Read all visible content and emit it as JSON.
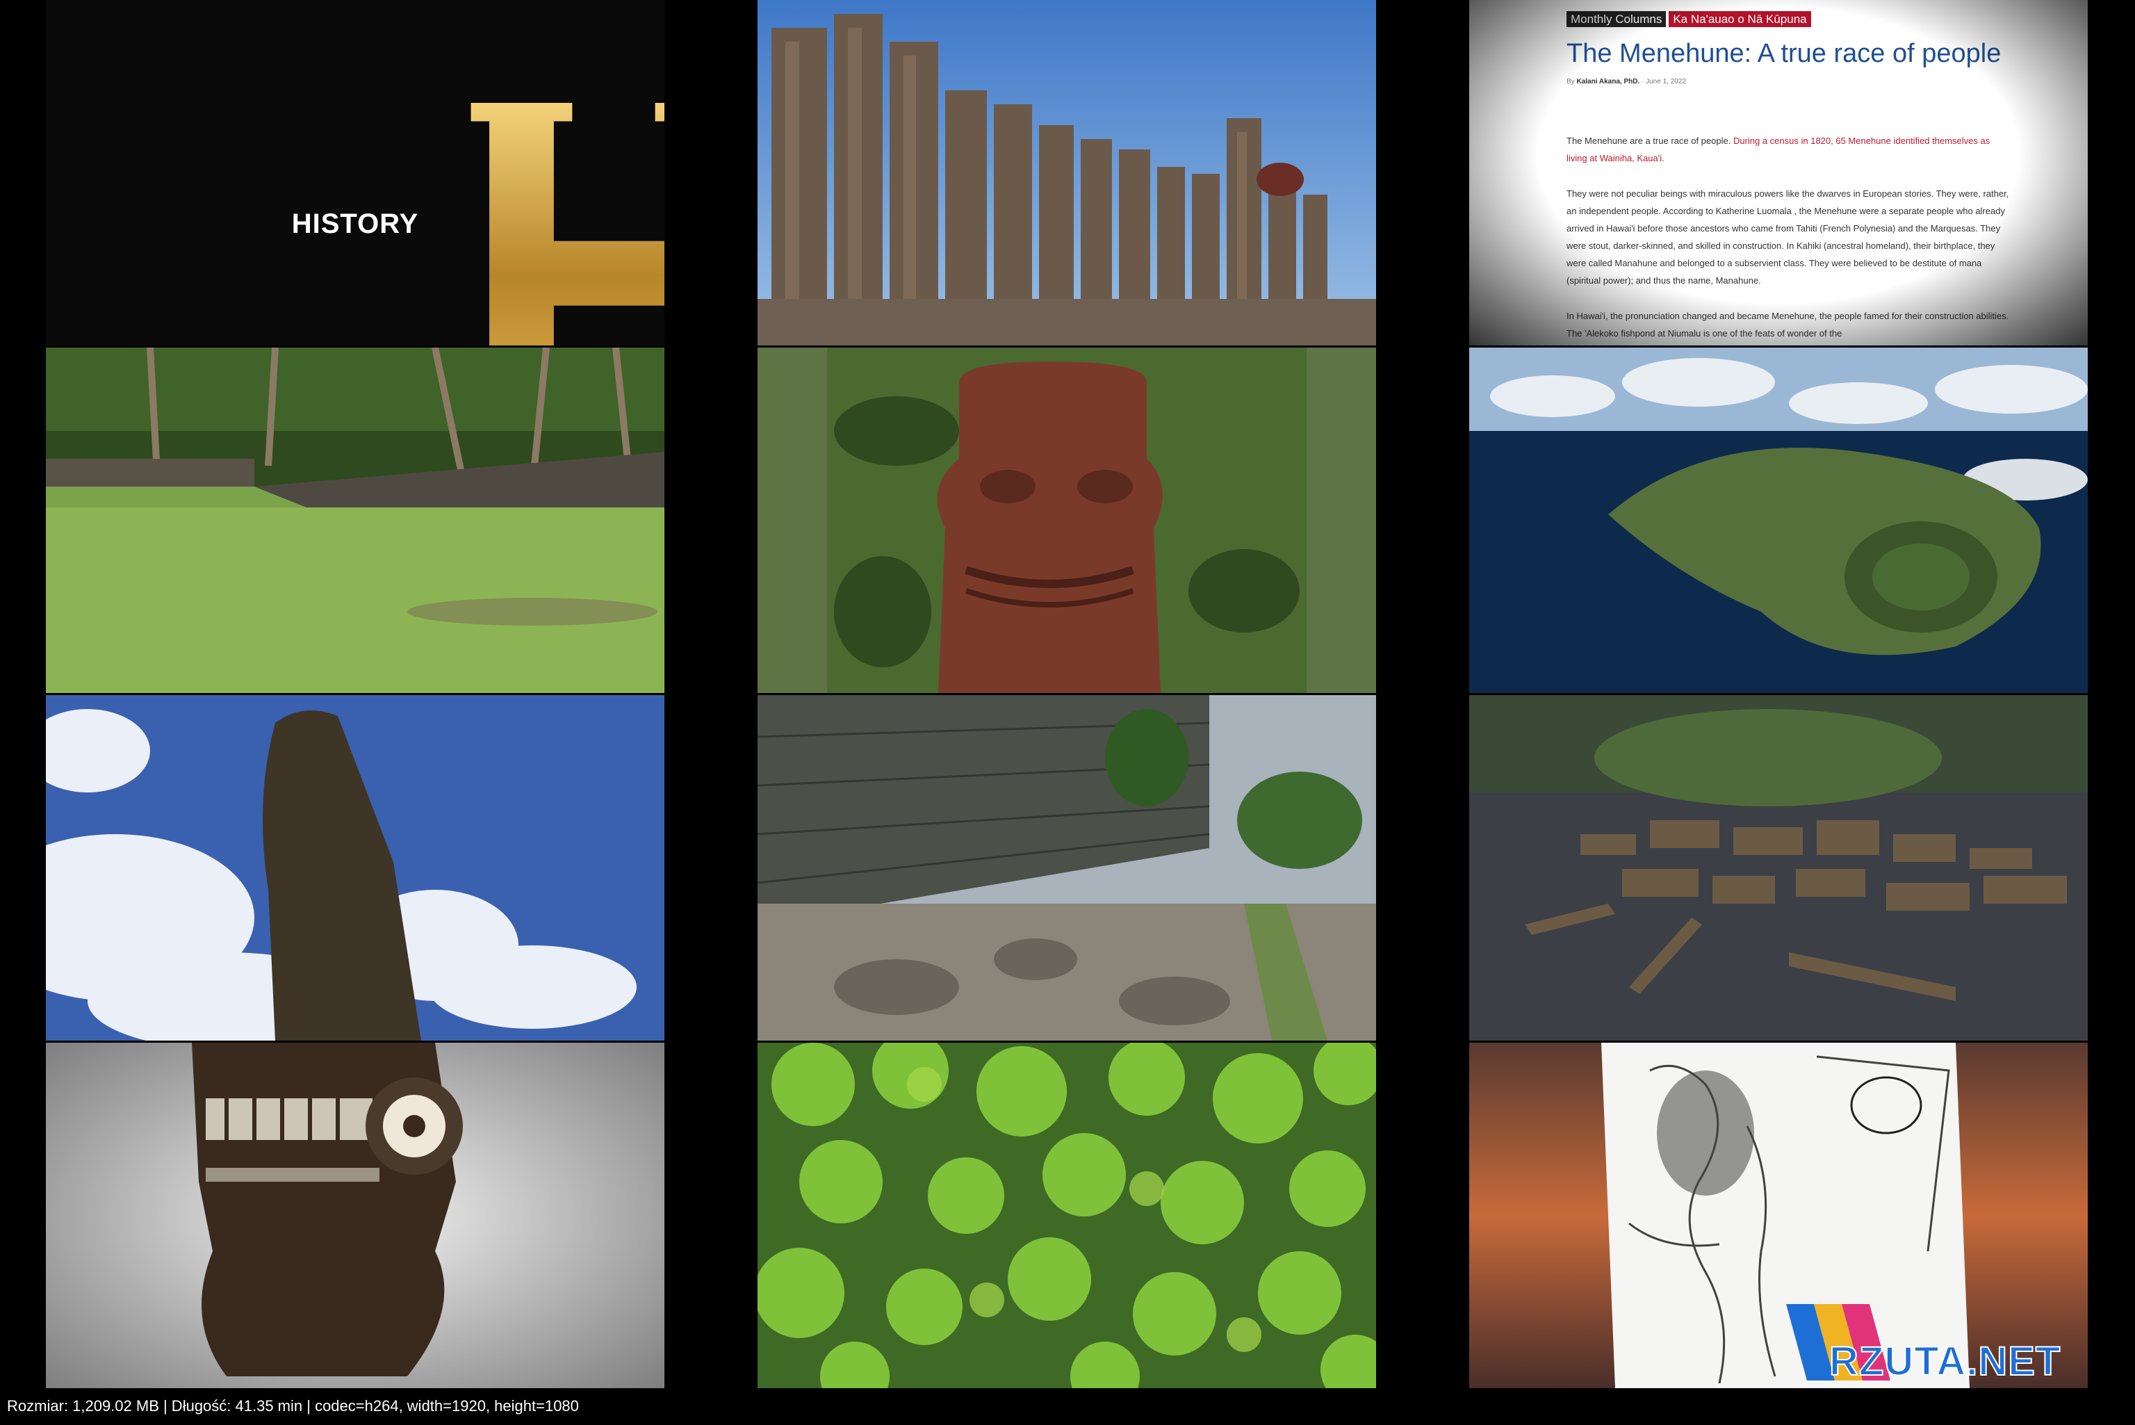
{
  "logo": {
    "letter": "H",
    "text": "HISTORY",
    "gold": "#c9962b"
  },
  "article": {
    "tag1": "Monthly Columns",
    "tag2": "Ka Na'auao o Nā Kūpuna",
    "title": "The Menehune: A true race of people",
    "author": "Kalani Akana, PhD.",
    "date": "June 1, 2022",
    "p1_black": "The Menehune are a true race of people. ",
    "p1_red": "During a census in 1820, 65 Menehune identified themselves as living at Wainiha, Kaua'i.",
    "p2": "They were not peculiar beings with miraculous powers like the dwarves in European stories. They were, rather, an independent people. According to Katherine Luomala , the Menehune were a separate people who already arrived in Hawai'i before those ancestors who came from Tahiti (French Polynesia) and the Marquesas. They were stout, darker-skinned, and skilled in construction. In Kahiki (ancestral homeland), their birthplace, they were called Manahune and belonged to a subservient class. They were believed to be destitute of mana (spiritual power); and thus the name, Manahune.",
    "p3": "In Hawai'i, the pronunciation changed and became Menehune, the people famed for their construction abilities. The 'Alekoko fishpond at Niumalu is one of the feats of wonder of the"
  },
  "watermark": {
    "text": "RZUTA.NET"
  },
  "info": "Rozmiar: 1,209.02 MB | Długość: 41.35 min | codec=h264, width=1920, height=1080"
}
